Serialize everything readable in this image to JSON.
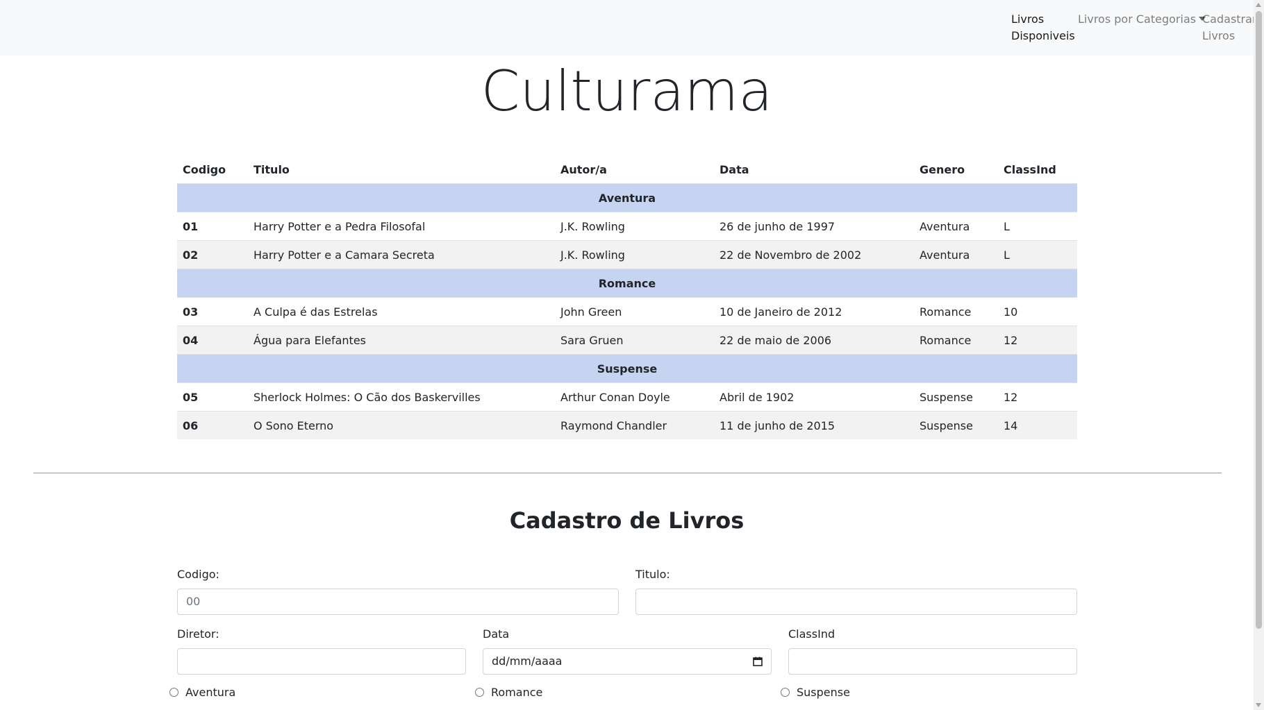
{
  "nav": {
    "items": [
      {
        "line1": "Livros",
        "line2": "Disponiveis"
      },
      {
        "label": "Livros por Categorias"
      },
      {
        "line1": "Cadastrar",
        "line2": "Livros"
      }
    ]
  },
  "page": {
    "title": "Culturama"
  },
  "table": {
    "headers": [
      "Codigo",
      "Titulo",
      "Autor/a",
      "Data",
      "Genero",
      "ClassInd"
    ],
    "groups": [
      {
        "category": "Aventura",
        "rows": [
          [
            "01",
            "Harry Potter e a Pedra Filosofal",
            "J.K. Rowling",
            "26 de junho de 1997",
            "Aventura",
            "L"
          ],
          [
            "02",
            "Harry Potter e a Camara Secreta",
            "J.K. Rowling",
            "22 de Novembro de 2002",
            "Aventura",
            "L"
          ]
        ]
      },
      {
        "category": "Romance",
        "rows": [
          [
            "03",
            "A Culpa é das Estrelas",
            "John Green",
            "10 de Janeiro de 2012",
            "Romance",
            "10"
          ],
          [
            "04",
            "Água para Elefantes",
            "Sara Gruen",
            "22 de maio de 2006",
            "Romance",
            "12"
          ]
        ]
      },
      {
        "category": "Suspense",
        "rows": [
          [
            "05",
            "Sherlock Holmes: O Cão dos Baskervilles",
            "Arthur Conan Doyle",
            "Abril de 1902",
            "Suspense",
            "12"
          ],
          [
            "06",
            "O Sono Eterno",
            "Raymond Chandler",
            "11 de junho de 2015",
            "Suspense",
            "14"
          ]
        ]
      }
    ]
  },
  "form": {
    "title": "Cadastro de Livros",
    "codigo": {
      "label": "Codigo:",
      "placeholder": "00",
      "value": ""
    },
    "titulo": {
      "label": "Titulo:",
      "value": ""
    },
    "diretor": {
      "label": "Diretor:",
      "value": ""
    },
    "data": {
      "label": "Data",
      "placeholder": "dd/mm/aaaa"
    },
    "classind": {
      "label": "ClassInd",
      "value": ""
    },
    "genres": [
      "Aventura",
      "Romance",
      "Suspense"
    ]
  },
  "colors": {
    "category_row": "#c6d4f1",
    "striped_row": "#f2f2f2",
    "navbar": "#f8f9fa",
    "divider": "#6aa0d0"
  }
}
